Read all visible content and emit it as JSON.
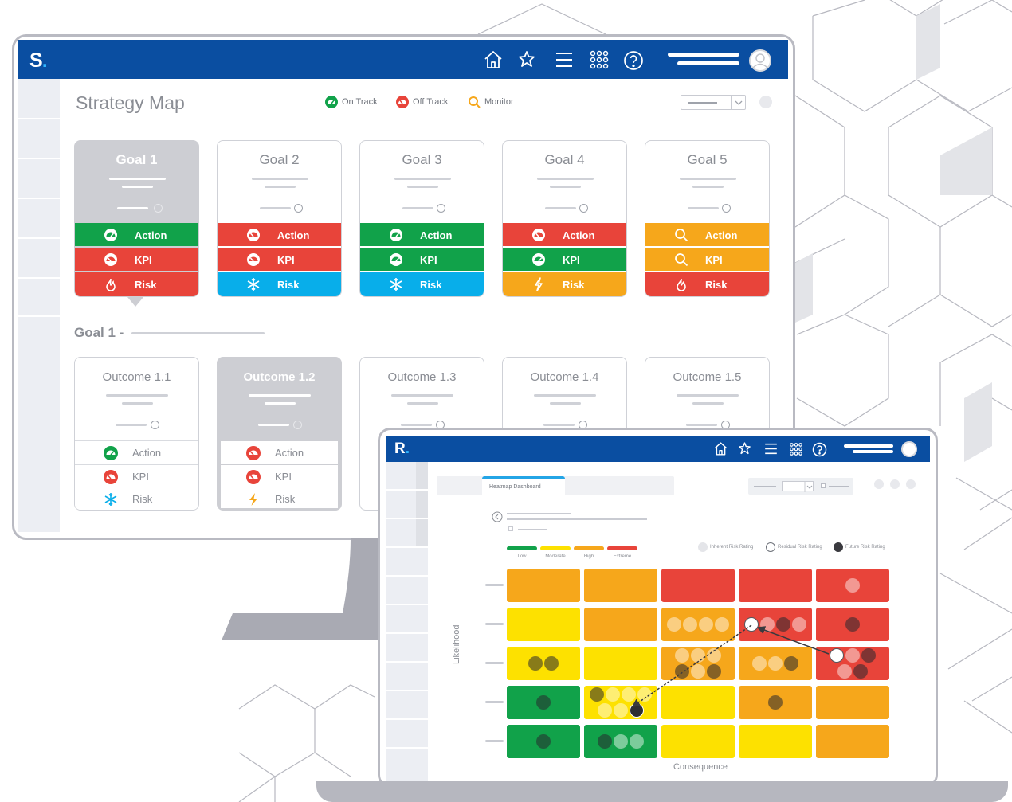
{
  "monitor": {
    "logo": "S",
    "logo_dot": ".",
    "page_title": "Strategy Map",
    "nav_icons": [
      "home-icon",
      "puzzle-icon",
      "menu-icon",
      "apps-grid-icon",
      "help-icon"
    ],
    "legend": [
      {
        "label": "On Track",
        "icon": "on-track-gauge-icon",
        "color": "#11a24a"
      },
      {
        "label": "Off Track",
        "icon": "off-track-gauge-icon",
        "color": "#e8443a"
      },
      {
        "label": "Monitor",
        "icon": "magnifier-icon",
        "color": "#f6a71b"
      }
    ],
    "goals": [
      {
        "title": "Goal 1",
        "selected": true,
        "rows": [
          {
            "label": "Action",
            "status": "green",
            "icon": "gauge-icon"
          },
          {
            "label": "KPI",
            "status": "red",
            "icon": "gauge-icon"
          },
          {
            "label": "Risk",
            "status": "red",
            "icon": "flame-icon"
          }
        ]
      },
      {
        "title": "Goal 2",
        "selected": false,
        "rows": [
          {
            "label": "Action",
            "status": "red",
            "icon": "gauge-icon"
          },
          {
            "label": "KPI",
            "status": "red",
            "icon": "gauge-icon"
          },
          {
            "label": "Risk",
            "status": "blue",
            "icon": "snowflake-icon"
          }
        ]
      },
      {
        "title": "Goal 3",
        "selected": false,
        "rows": [
          {
            "label": "Action",
            "status": "green",
            "icon": "gauge-icon"
          },
          {
            "label": "KPI",
            "status": "green",
            "icon": "gauge-icon"
          },
          {
            "label": "Risk",
            "status": "blue",
            "icon": "snowflake-icon"
          }
        ]
      },
      {
        "title": "Goal 4",
        "selected": false,
        "rows": [
          {
            "label": "Action",
            "status": "red",
            "icon": "gauge-icon"
          },
          {
            "label": "KPI",
            "status": "green",
            "icon": "gauge-icon"
          },
          {
            "label": "Risk",
            "status": "orange",
            "icon": "lightning-icon"
          }
        ]
      },
      {
        "title": "Goal 5",
        "selected": false,
        "rows": [
          {
            "label": "Action",
            "status": "orange",
            "icon": "magnifier-icon"
          },
          {
            "label": "KPI",
            "status": "orange",
            "icon": "magnifier-icon"
          },
          {
            "label": "Risk",
            "status": "red",
            "icon": "flame-icon"
          }
        ]
      }
    ],
    "goal_section_label": "Goal 1 -",
    "outcomes": [
      {
        "title": "Outcome 1.1",
        "selected": false,
        "rows": [
          {
            "label": "Action",
            "icon": "on-track-gauge-icon"
          },
          {
            "label": "KPI",
            "icon": "off-track-gauge-icon"
          },
          {
            "label": "Risk",
            "icon": "snowflake-icon"
          }
        ]
      },
      {
        "title": "Outcome 1.2",
        "selected": true,
        "rows": [
          {
            "label": "Action",
            "icon": "off-track-gauge-icon"
          },
          {
            "label": "KPI",
            "icon": "off-track-gauge-icon"
          },
          {
            "label": "Risk",
            "icon": "lightning-icon"
          }
        ]
      },
      {
        "title": "Outcome 1.3",
        "selected": false,
        "rows": []
      },
      {
        "title": "Outcome 1.4",
        "selected": false,
        "rows": []
      },
      {
        "title": "Outcome 1.5",
        "selected": false,
        "rows": []
      }
    ]
  },
  "tablet": {
    "logo": "R",
    "logo_dot": ".",
    "tab_label": "Heatmap Dashboard",
    "risk_levels": [
      {
        "label": "Low",
        "color": "#11a24a"
      },
      {
        "label": "Moderate",
        "color": "#fde100"
      },
      {
        "label": "High",
        "color": "#f6a71b"
      },
      {
        "label": "Extreme",
        "color": "#e8443a"
      }
    ],
    "rating_legend": [
      {
        "label": "Inherent Risk Rating",
        "style": "light-grey-fill"
      },
      {
        "label": "Residual Risk Rating",
        "style": "white-outline"
      },
      {
        "label": "Future Risk Rating",
        "style": "dark-fill"
      }
    ],
    "y_axis_label": "Likelihood",
    "x_axis_label": "Consequence"
  },
  "chart_data": {
    "type": "heatmap",
    "title": "",
    "xlabel": "Consequence",
    "ylabel": "Likelihood",
    "rows": 5,
    "cols": 5,
    "cell_colors": [
      [
        "orange",
        "orange",
        "red",
        "red",
        "red"
      ],
      [
        "yellow",
        "orange",
        "orange",
        "red",
        "red"
      ],
      [
        "yellow",
        "yellow",
        "orange",
        "orange",
        "red"
      ],
      [
        "green",
        "yellow",
        "yellow",
        "orange",
        "orange"
      ],
      [
        "green",
        "green",
        "yellow",
        "yellow",
        "orange"
      ]
    ],
    "markers": [
      {
        "row": 0,
        "col": 4,
        "kinds": [
          "inherent"
        ]
      },
      {
        "row": 1,
        "col": 2,
        "kinds": [
          "inherent",
          "inherent",
          "inherent",
          "inherent"
        ]
      },
      {
        "row": 1,
        "col": 3,
        "kinds": [
          "residual",
          "inherent",
          "future",
          "inherent"
        ]
      },
      {
        "row": 1,
        "col": 4,
        "kinds": [
          "future"
        ]
      },
      {
        "row": 2,
        "col": 0,
        "kinds": [
          "future",
          "future"
        ]
      },
      {
        "row": 2,
        "col": 2,
        "kinds": [
          "inherent",
          "inherent",
          "inherent",
          "future",
          "inherent",
          "future"
        ]
      },
      {
        "row": 2,
        "col": 3,
        "kinds": [
          "inherent",
          "inherent",
          "future"
        ]
      },
      {
        "row": 2,
        "col": 4,
        "kinds": [
          "residual",
          "inherent",
          "future",
          "inherent",
          "future"
        ]
      },
      {
        "row": 3,
        "col": 0,
        "kinds": [
          "future"
        ]
      },
      {
        "row": 3,
        "col": 1,
        "kinds": [
          "future",
          "inherent",
          "inherent",
          "inherent",
          "inherent",
          "inherent",
          "future"
        ]
      },
      {
        "row": 3,
        "col": 3,
        "kinds": [
          "future"
        ]
      },
      {
        "row": 4,
        "col": 0,
        "kinds": [
          "future"
        ]
      },
      {
        "row": 4,
        "col": 1,
        "kinds": [
          "future",
          "inherent",
          "inherent"
        ]
      }
    ]
  }
}
